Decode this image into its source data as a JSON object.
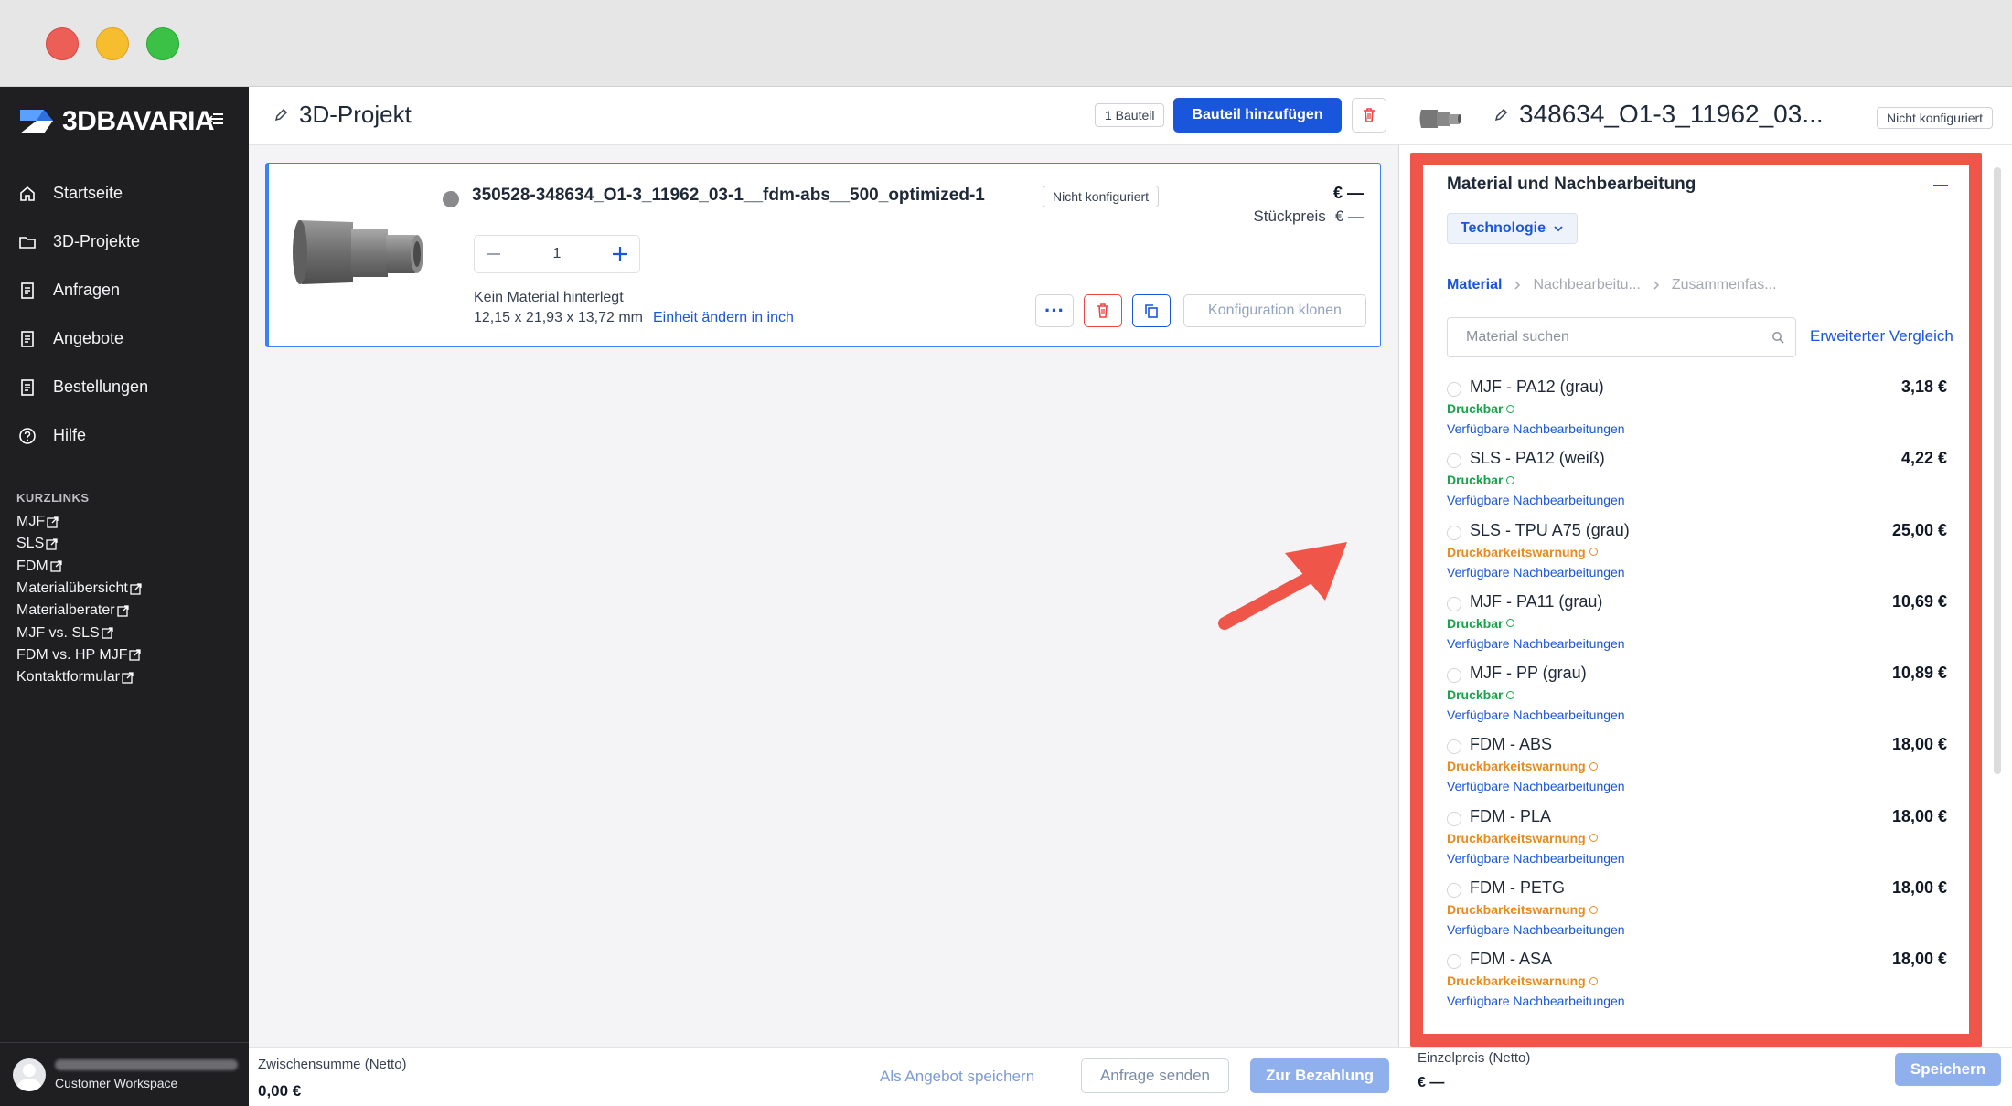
{
  "brand": {
    "name": "3DBAVARIA"
  },
  "nav": [
    {
      "label": "Startseite",
      "icon": "home-icon"
    },
    {
      "label": "3D-Projekte",
      "icon": "folder-icon"
    },
    {
      "label": "Anfragen",
      "icon": "document-icon"
    },
    {
      "label": "Angebote",
      "icon": "document-icon"
    },
    {
      "label": "Bestellungen",
      "icon": "document-icon"
    },
    {
      "label": "Hilfe",
      "icon": "help-icon"
    }
  ],
  "shortcuts": {
    "title": "KURZLINKS",
    "items": [
      "MJF",
      "SLS",
      "FDM",
      "Materialübersicht",
      "Materialberater",
      "MJF vs. SLS",
      "FDM vs. HP MJF",
      "Kontaktformular"
    ]
  },
  "account": {
    "workspace": "Customer Workspace"
  },
  "project": {
    "title": "3D-Projekt",
    "count_badge": "1 Bauteil",
    "add_button": "Bauteil hinzufügen"
  },
  "part": {
    "name": "350528-348634_O1-3_11962_03-1__fdm-abs__500_optimized-1",
    "status_tag": "Nicht konfiguriert",
    "price": "€ —",
    "unit_price_label": "Stückpreis",
    "unit_price_value": "€ —",
    "quantity": "1",
    "material": "Kein Material hinterlegt",
    "dimensions": "12,15 x 21,93 x 13,72 mm",
    "unit_link": "Einheit ändern in inch",
    "more": "···",
    "clone_button": "Konfiguration klonen"
  },
  "footer": {
    "subtotal_label": "Zwischensumme (Netto)",
    "subtotal_value": "0,00 €",
    "save_offer": "Als Angebot speichern",
    "send_request": "Anfrage senden",
    "pay": "Zur Bezahlung"
  },
  "panel": {
    "title": "348634_O1-3_11962_03...",
    "status_tag": "Nicht konfiguriert",
    "section_title": "Material und Nachbearbeitung",
    "technology_button": "Technologie",
    "steps": [
      "Material",
      "Nachbearbeitu...",
      "Zusammenfas..."
    ],
    "search_placeholder": "Material suchen",
    "compare_link": "Erweiterter Vergleich",
    "materials": [
      {
        "name": "MJF - PA12 (grau)",
        "price": "3,18 €",
        "status": "Druckbar",
        "ok": true,
        "post": "Verfügbare Nachbearbeitungen"
      },
      {
        "name": "SLS - PA12 (weiß)",
        "price": "4,22 €",
        "status": "Druckbar",
        "ok": true,
        "post": "Verfügbare Nachbearbeitungen"
      },
      {
        "name": "SLS - TPU A75 (grau)",
        "price": "25,00 €",
        "status": "Druckbarkeitswarnung",
        "ok": false,
        "post": "Verfügbare Nachbearbeitungen"
      },
      {
        "name": "MJF - PA11 (grau)",
        "price": "10,69 €",
        "status": "Druckbar",
        "ok": true,
        "post": "Verfügbare Nachbearbeitungen"
      },
      {
        "name": "MJF - PP (grau)",
        "price": "10,89 €",
        "status": "Druckbar",
        "ok": true,
        "post": "Verfügbare Nachbearbeitungen"
      },
      {
        "name": "FDM - ABS",
        "price": "18,00 €",
        "status": "Druckbarkeitswarnung",
        "ok": false,
        "post": "Verfügbare Nachbearbeitungen"
      },
      {
        "name": "FDM - PLA",
        "price": "18,00 €",
        "status": "Druckbarkeitswarnung",
        "ok": false,
        "post": "Verfügbare Nachbearbeitungen"
      },
      {
        "name": "FDM - PETG",
        "price": "18,00 €",
        "status": "Druckbarkeitswarnung",
        "ok": false,
        "post": "Verfügbare Nachbearbeitungen"
      },
      {
        "name": "FDM - ASA",
        "price": "18,00 €",
        "status": "Druckbarkeitswarnung",
        "ok": false,
        "post": "Verfügbare Nachbearbeitungen"
      }
    ],
    "single_price_label": "Einzelpreis (Netto)",
    "single_price_value": "€ —",
    "save_button": "Speichern"
  },
  "colors": {
    "primary": "#1a56db",
    "sidebar": "#1f1f22",
    "highlight": "#f0554a",
    "ok": "#16a34a",
    "warn": "#ea8a1f"
  }
}
